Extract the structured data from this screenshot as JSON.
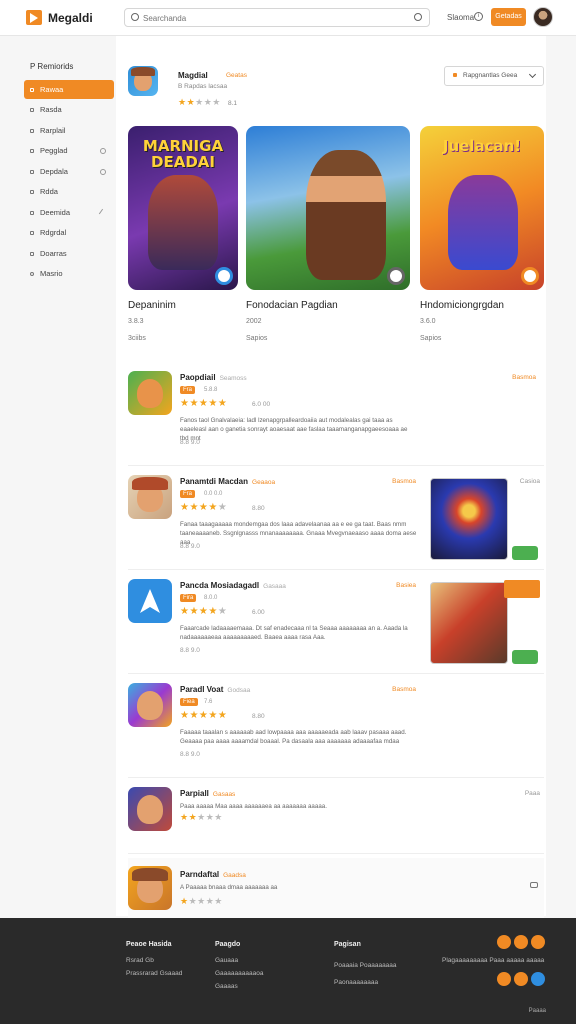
{
  "header": {
    "brand": "Megaldi",
    "search_placeholder": "Searchanda",
    "link": "Slaoma",
    "button": "Getadas",
    "colors": {
      "accent": "#f08a24"
    }
  },
  "sidebar": {
    "title": "P Remiorids",
    "items": [
      {
        "label": "Rawaa",
        "active": true
      },
      {
        "label": "Rasda"
      },
      {
        "label": "Rarplail"
      },
      {
        "label": "Pegglad"
      },
      {
        "label": "Depdala"
      },
      {
        "label": "Rdda"
      },
      {
        "label": "Deemida"
      },
      {
        "label": "Rdgrdal"
      },
      {
        "label": "Doarras"
      },
      {
        "label": "Masrio"
      }
    ]
  },
  "featured": {
    "title": "Magdial",
    "tag": "Geatas",
    "sub": "B Rapdas lacsaa",
    "rating": 2,
    "meta": "8.1",
    "dropdown": "Rapgnantlas Geea"
  },
  "cards": [
    {
      "art_title": "MARNIGA DEADAI",
      "title": "Depaninim",
      "v1": "3.8.3",
      "v2": "3ciibs"
    },
    {
      "art_title": "",
      "title": "Fonodacian Pagdian",
      "v1": "2002",
      "v2": "Sapios"
    },
    {
      "art_title": "Juelacan!",
      "title": "Hndomiciongrgdan",
      "v1": "3.6.0",
      "v2": "Sapios"
    }
  ],
  "rows": [
    {
      "name": "Paopdiail",
      "cat": "Seamoss",
      "right": "Basmoa",
      "pill": "Fra",
      "pill_sub": "5.8.8",
      "rating": 5,
      "score": "6.0 00",
      "desc": "Fanos taol Gnalvalaeia: ladl lzenapgrpalleardoaiia aut modalealas gai taaa as eaaeleasl aan o ganetia sonrayt aoaesaat aae faslaa taaamanganapgaeesoaaa ae tbd mnt",
      "meta": "8.8  9.0"
    },
    {
      "name": "Panamtdi Macdan",
      "cat": "Geaaoa",
      "right": "Basmoa",
      "pill": "Fra",
      "pill_sub": "0.0 0.0",
      "rating": 4,
      "score": "8.80",
      "desc": "Fanaa taaagaaaaa mondemgaa dos laaa adavelaanaa aa e ee ga taat. Baas nmm taaneaaaaneb. Ssgnlgnasss mnanaaaaaaaa. Gnaaa Mvegvnaeaaso aaaa doma aese aaa",
      "meta": "8.8  9.0",
      "thumb": "thumb1",
      "thumb_meta": "Casioa"
    },
    {
      "name": "Pancda Mosiadagadl",
      "cat": "Gasaaa",
      "right": "Basiea",
      "pill": "Fira",
      "pill_sub": "8.0.0",
      "rating": 4,
      "score": "6.00",
      "desc": "Faaarcade ladaaaaemaaa. Dt saf enadecaaa nl ta Seaaa aaaaaaaa an a. Aaada la nadaaaaaaeaa aaaaaaaaaed. Baaea aaaa rasa Aaa.",
      "meta": "8.8  9.0",
      "thumb": "thumb2",
      "thumb_meta": ""
    },
    {
      "name": "Paradl Voat",
      "cat": "Godsaa",
      "right": "Basmoa",
      "pill": "Fiea",
      "pill_sub": "7.6",
      "rating": 5,
      "score": "8.80",
      "desc": "Faaaaa taaalan s aaaaaab aad lowpaaaa aaa aaaaaeada aab laaav pasaaa aaad. Geaaaa paa aaaa aaaamdal boaaal. Pa dasaala aaa aaaaaaa adaaaafaa mdaa",
      "meta": "8.8  9.0"
    },
    {
      "name": "Parpiall",
      "cat": "Gasaas",
      "right": "Paaa",
      "pill": "",
      "pill_sub": "",
      "rating": 2,
      "score": "",
      "desc": "Paaa aaaaa Maa aaaa aaaaaaea aa aaaaaaa aaaaa.",
      "meta": "8.8 9.0"
    },
    {
      "name": "Parndaftal",
      "cat": "Gaadsa",
      "right": "",
      "pill": "",
      "pill_sub": "",
      "rating": 2,
      "score": "",
      "desc": "A Paaaaa bnaaa dmaa aaaaaaa aa",
      "meta": "8.8 9.0"
    }
  ],
  "footer": {
    "col1": {
      "h": "Peaoe Hasida",
      "items": [
        "Rsrad Gb",
        "Prassrarad Gsaaad"
      ]
    },
    "col2": {
      "h": "Paagdo",
      "items": [
        "Gauaaa",
        "Gaaaaaaaaaaoa",
        "Gaaaas"
      ]
    },
    "col3": {
      "h": "Pagisan",
      "items": [
        "Poaaaia Poaaaaaaaa",
        "Paonaaaaaaaa"
      ]
    },
    "right": "Plagaaaaaaaaa Paaa aaaaa aaaaa",
    "copy": "Paaaa"
  }
}
